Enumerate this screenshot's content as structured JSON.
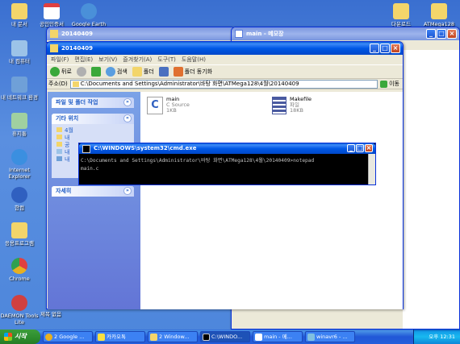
{
  "desktop_icons": [
    {
      "label": "내 문서",
      "color": "#f3d56a"
    },
    {
      "label": "공인인증서",
      "color": "#e04040"
    },
    {
      "label": "Google Earth",
      "color": "#4a90d9"
    },
    {
      "label": "내 컴퓨터",
      "color": "#9cc3e8"
    },
    {
      "label": "내 네트워크 환경",
      "color": "#6fa0d8"
    },
    {
      "label": "휴지통",
      "color": "#a0d0a0"
    },
    {
      "label": "Internet Explorer",
      "color": "#3b8fe0"
    },
    {
      "label": "한컴",
      "color": "#3060c0"
    },
    {
      "label": "응용프로그램",
      "color": "#f3d56a"
    },
    {
      "label": "Chrome",
      "color": "#e8b020"
    },
    {
      "label": "DAEMON Tools Lite",
      "color": "#d04040"
    },
    {
      "label": "다운로드",
      "color": "#f3d56a"
    },
    {
      "label": "ATMega128",
      "color": "#f3d56a"
    }
  ],
  "desktop_misc": {
    "untitled_label": "제목 없음"
  },
  "back_window": {
    "title": "20140409"
  },
  "notepad_window": {
    "title": "main - 메모장"
  },
  "explorer": {
    "title": "20140409",
    "menu": [
      "파일(F)",
      "편집(E)",
      "보기(V)",
      "즐겨찾기(A)",
      "도구(T)",
      "도움말(H)"
    ],
    "toolbar": {
      "back": "뒤로",
      "search": "검색",
      "folders": "폴더",
      "sync": "폴더 동기화"
    },
    "address_label": "주소(D)",
    "address_value": "C:\\Documents and Settings\\Administrator\\바탕 화면\\ATMega128\\4월\\20140409",
    "go_label": "이동",
    "tasks": {
      "file_folder_tasks": "파일 및 폴더 작업",
      "other_places": "기타 위치",
      "other_items": [
        "4월",
        "내",
        "공",
        "내",
        "내"
      ],
      "details": "자세히"
    },
    "files": [
      {
        "name": "main",
        "type": "C Source",
        "size": "1KB"
      },
      {
        "name": "Makefile",
        "type": "파일",
        "size": "18KB"
      }
    ]
  },
  "cmd": {
    "title": "C:\\WINDOWS\\system32\\cmd.exe",
    "line1": "C:\\Documents and Settings\\Administrator\\바탕 화면\\ATMega128\\4월\\20140409>notepad",
    "line2": " main.c"
  },
  "taskbar": {
    "start": "시작",
    "buttons": [
      "2 Google ...",
      "카카오톡",
      "2 Window...",
      "C:\\WINDO...",
      "main - 메...",
      "winavr6 - ..."
    ],
    "clock": "오후 12:31"
  }
}
